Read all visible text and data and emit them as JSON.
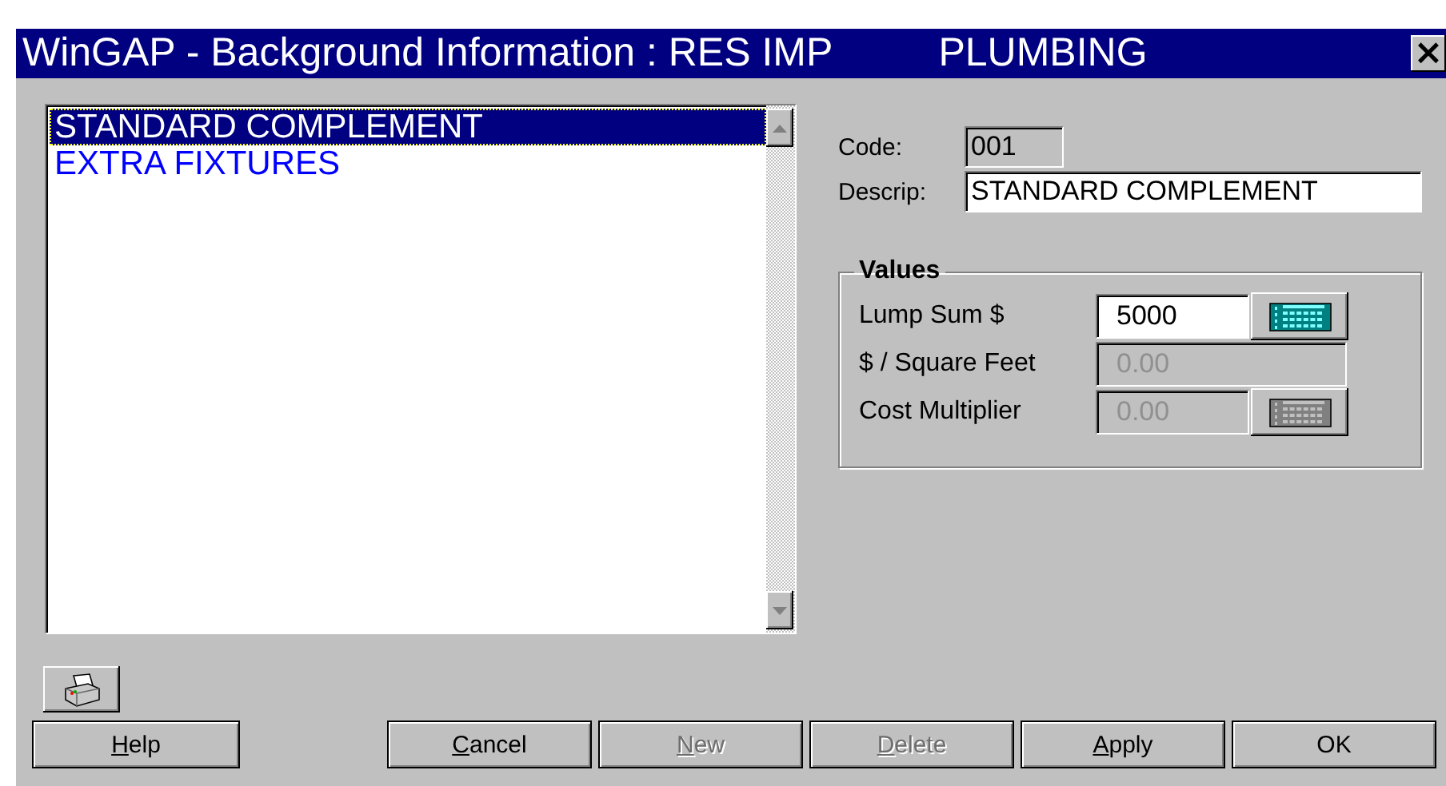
{
  "window": {
    "title": "WinGAP - Background Information : RES IMP",
    "subtitle": "PLUMBING",
    "close": "×"
  },
  "list": {
    "items": [
      {
        "label": "STANDARD COMPLEMENT",
        "selected": true
      },
      {
        "label": "EXTRA FIXTURES",
        "selected": false
      }
    ]
  },
  "details": {
    "code": {
      "label": "Code:",
      "value": "001",
      "disabled": true
    },
    "descrip": {
      "label": "Descrip:",
      "value": "STANDARD COMPLEMENT",
      "disabled": false
    }
  },
  "values": {
    "title": "Values",
    "fields": [
      {
        "label": "Lump Sum $",
        "value": "5000",
        "disabled": false,
        "calculator": {
          "disabled": false
        }
      },
      {
        "label": "$ / Square Feet",
        "value": "0.00",
        "disabled": true
      },
      {
        "label": "Cost Multiplier",
        "value": "0.00",
        "disabled": true,
        "calculator": {
          "disabled": true
        }
      }
    ]
  },
  "buttons": [
    {
      "label": "Help",
      "access_key": true,
      "disabled": false
    },
    {
      "label": "Cancel",
      "access_key": true,
      "disabled": false
    },
    {
      "label": "New",
      "access_key": true,
      "disabled": true
    },
    {
      "label": "Delete",
      "access_key": true,
      "disabled": true
    },
    {
      "label": "Apply",
      "access_key": true,
      "disabled": false
    },
    {
      "label": "OK",
      "access_key": false,
      "disabled": false
    }
  ]
}
